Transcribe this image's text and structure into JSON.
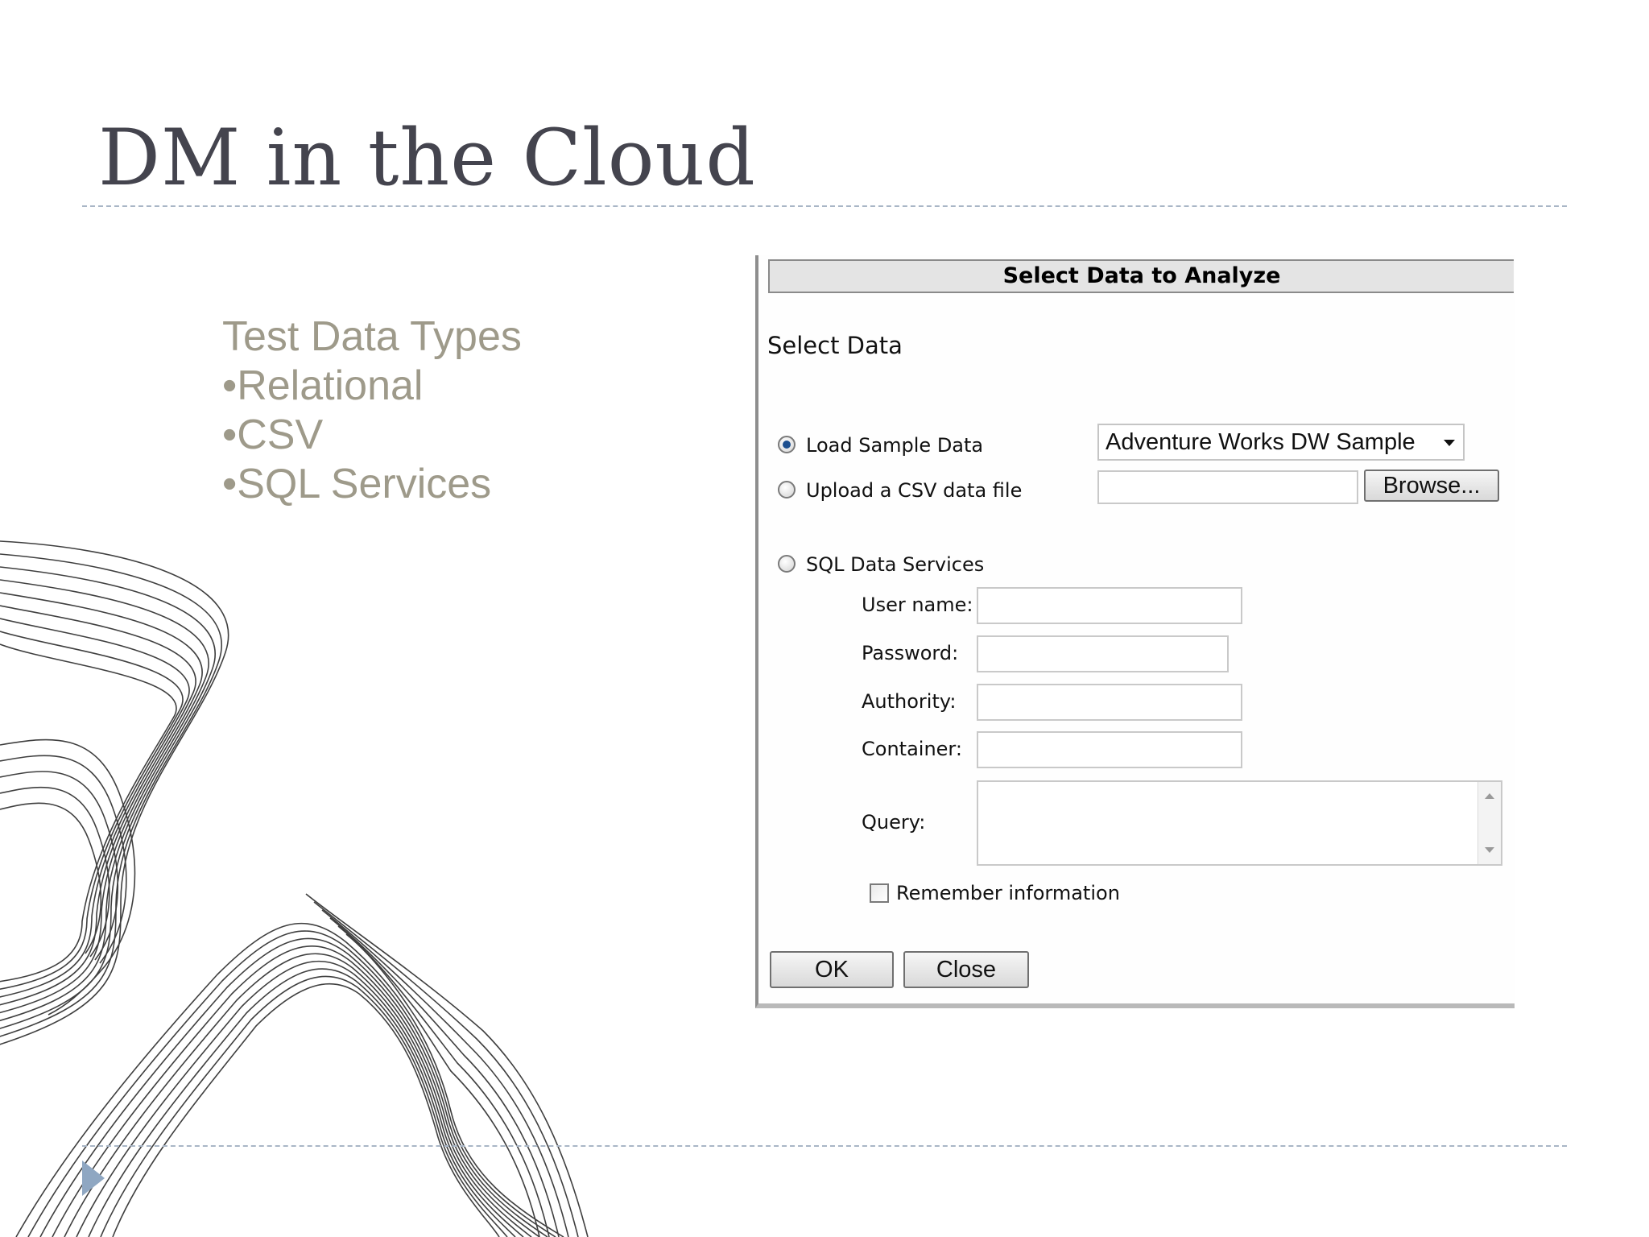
{
  "slide": {
    "title": "DM in the Cloud",
    "bullets": [
      "Test Data Types",
      "•Relational",
      "•CSV",
      "•SQL Services"
    ]
  },
  "dialog": {
    "title": "Select Data to Analyze",
    "section_label": "Select Data",
    "options": {
      "load_sample": {
        "label": "Load Sample Data",
        "checked": true
      },
      "upload_csv": {
        "label": "Upload a CSV data file",
        "checked": false
      },
      "sql_services": {
        "label": "SQL Data Services",
        "checked": false
      }
    },
    "sample_select_value": "Adventure Works DW Sample",
    "csv_file_value": "",
    "browse_label": "Browse...",
    "fields": {
      "username_label": "User name:",
      "password_label": "Password:",
      "authority_label": "Authority:",
      "container_label": "Container:",
      "query_label": "Query:"
    },
    "remember_label": "Remember information",
    "remember_checked": false,
    "ok_label": "OK",
    "close_label": "Close"
  },
  "colors": {
    "title": "#44444e",
    "bullets": "#9e9a8a",
    "dashed_rule": "#a9b6c6",
    "nav_arrow": "#8fa7c2"
  },
  "icons": [
    "nav-arrow-icon",
    "chevron-down-icon",
    "scroll-up-icon",
    "scroll-down-icon"
  ]
}
